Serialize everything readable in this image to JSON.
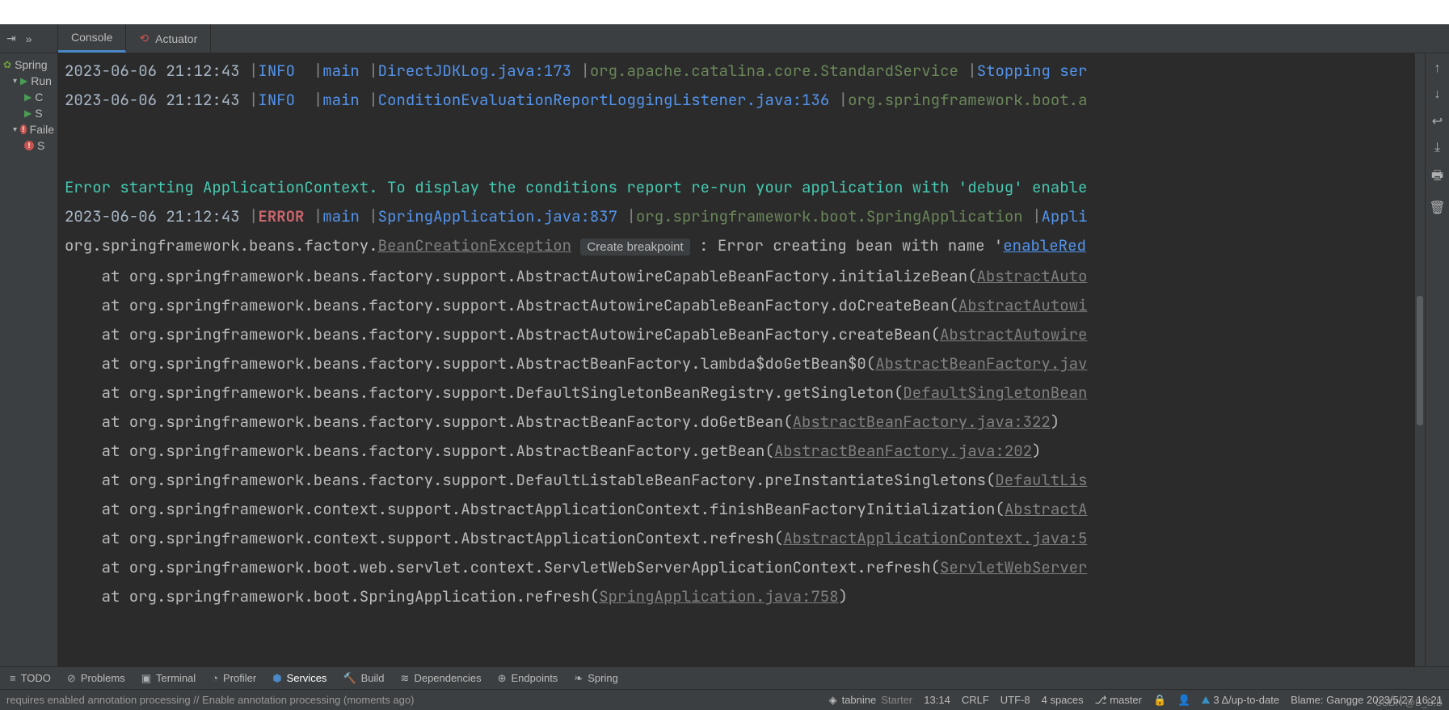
{
  "tabs": {
    "console": "Console",
    "actuator": "Actuator"
  },
  "tree": {
    "root": "Spring",
    "running": "Run",
    "item_c": "C",
    "item_s": "S",
    "failed": "Faile",
    "failed_item": "S"
  },
  "log": {
    "l1": {
      "ts": "2023-06-06 21:12:43",
      "level": "INFO",
      "thread": "main",
      "src": "DirectJDKLog.java:173",
      "logger": "org.apache.catalina.core.StandardService",
      "msg": "Stopping ser"
    },
    "l2": {
      "ts": "2023-06-06 21:12:43",
      "level": "INFO",
      "thread": "main",
      "src": "ConditionEvaluationReportLoggingListener.java:136",
      "logger": "org.springframework.boot.a"
    },
    "err_banner": "Error starting ApplicationContext. To display the conditions report re-run your application with 'debug' enable",
    "l3": {
      "ts": "2023-06-06 21:12:43",
      "level": "ERROR",
      "thread": "main",
      "src": "SpringApplication.java:837",
      "logger": "org.springframework.boot.SpringApplication",
      "msg": "Appli"
    },
    "exc_prefix": "org.springframework.beans.factory.",
    "exc_name": "BeanCreationException",
    "create_bp": "Create breakpoint",
    "exc_rest": " : Error creating bean with name '",
    "exc_link": "enableRed",
    "stack": [
      {
        "pre": "    at org.springframework.beans.factory.support.AbstractAutowireCapableBeanFactory.initializeBean(",
        "link": "AbstractAuto"
      },
      {
        "pre": "    at org.springframework.beans.factory.support.AbstractAutowireCapableBeanFactory.doCreateBean(",
        "link": "AbstractAutowi"
      },
      {
        "pre": "    at org.springframework.beans.factory.support.AbstractAutowireCapableBeanFactory.createBean(",
        "link": "AbstractAutowire"
      },
      {
        "pre": "    at org.springframework.beans.factory.support.AbstractBeanFactory.lambda$doGetBean$0(",
        "link": "AbstractBeanFactory.jav"
      },
      {
        "pre": "    at org.springframework.beans.factory.support.DefaultSingletonBeanRegistry.getSingleton(",
        "link": "DefaultSingletonBean"
      },
      {
        "pre": "    at org.springframework.beans.factory.support.AbstractBeanFactory.doGetBean(",
        "link": "AbstractBeanFactory.java:322",
        "close": ")"
      },
      {
        "pre": "    at org.springframework.beans.factory.support.AbstractBeanFactory.getBean(",
        "link": "AbstractBeanFactory.java:202",
        "close": ")"
      },
      {
        "pre": "    at org.springframework.beans.factory.support.DefaultListableBeanFactory.preInstantiateSingletons(",
        "link": "DefaultLis"
      },
      {
        "pre": "    at org.springframework.context.support.AbstractApplicationContext.finishBeanFactoryInitialization(",
        "link": "AbstractA"
      },
      {
        "pre": "    at org.springframework.context.support.AbstractApplicationContext.refresh(",
        "link": "AbstractApplicationContext.java:5"
      },
      {
        "pre": "    at org.springframework.boot.web.servlet.context.ServletWebServerApplicationContext.refresh(",
        "link": "ServletWebServer"
      },
      {
        "pre": "    at org.springframework.boot.SpringApplication.refresh(",
        "link": "SpringApplication.java:758",
        "close": ")"
      }
    ]
  },
  "bottom_tools": {
    "todo": "TODO",
    "problems": "Problems",
    "terminal": "Terminal",
    "profiler": "Profiler",
    "services": "Services",
    "build": "Build",
    "dependencies": "Dependencies",
    "endpoints": "Endpoints",
    "spring": "Spring"
  },
  "status": {
    "msg": "requires enabled annotation processing // Enable annotation processing (moments ago)",
    "tabnine": "tabnine",
    "tabnine_tier": "Starter",
    "pos": "13:14",
    "eol": "CRLF",
    "enc": "UTF-8",
    "indent": "4 spaces",
    "branch": "master",
    "delta": "3 Δ/up-to-date",
    "blame": "Blame: Gangge 2023/5/27 16:21"
  },
  "watermark": "CSDN @B_B.B"
}
